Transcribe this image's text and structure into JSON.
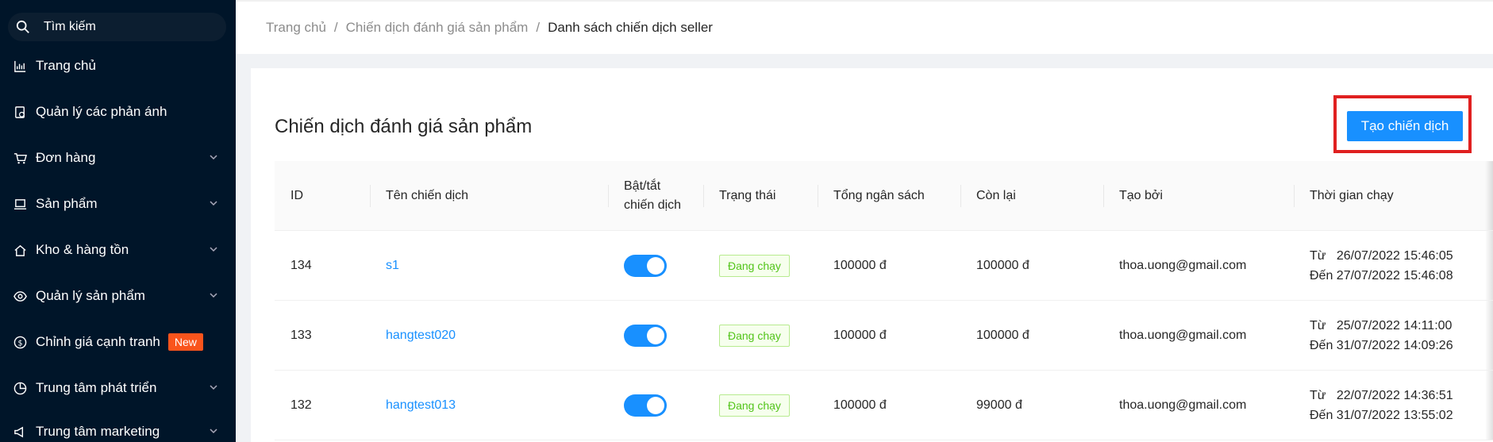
{
  "sidebar": {
    "search_placeholder": "Tìm kiếm",
    "items": [
      {
        "label": "Trang chủ",
        "icon": "chart-icon",
        "expandable": false
      },
      {
        "label": "Quản lý các phản ánh",
        "icon": "report-icon",
        "expandable": false
      },
      {
        "label": "Đơn hàng",
        "icon": "cart-icon",
        "expandable": true
      },
      {
        "label": "Sản phẩm",
        "icon": "laptop-icon",
        "expandable": true
      },
      {
        "label": "Kho & hàng tồn",
        "icon": "home-icon",
        "expandable": true
      },
      {
        "label": "Quản lý sản phẩm",
        "icon": "eye-icon",
        "expandable": true
      },
      {
        "label": "Chỉnh giá cạnh tranh",
        "icon": "dollar-icon",
        "expandable": false,
        "badge": "New"
      },
      {
        "label": "Trung tâm phát triển",
        "icon": "pie-chart-icon",
        "expandable": true
      },
      {
        "label": "Trung tâm marketing",
        "icon": "megaphone-icon",
        "expandable": true
      }
    ]
  },
  "breadcrumb": [
    "Trang chủ",
    "Chiến dịch đánh giá sản phẩm",
    "Danh sách chiến dịch seller"
  ],
  "page": {
    "title": "Chiến dịch đánh giá sản phẩm",
    "create_button": "Tạo chiến dịch"
  },
  "table": {
    "headers": [
      "ID",
      "Tên chiến dịch",
      "Bật/tắt\nchiến dịch",
      "Trạng thái",
      "Tổng ngân sách",
      "Còn lại",
      "Tạo bởi",
      "Thời gian chạy"
    ],
    "rows": [
      {
        "id": "134",
        "name": "s1",
        "enabled": true,
        "status": "Đang chạy",
        "budget": "100000 đ",
        "remaining": "100000 đ",
        "created_by": "thoa.uong@gmail.com",
        "from": "Từ   26/07/2022 15:46:05",
        "to": "Đến 27/07/2022 15:46:08"
      },
      {
        "id": "133",
        "name": "hangtest020",
        "enabled": true,
        "status": "Đang chạy",
        "budget": "100000 đ",
        "remaining": "100000 đ",
        "created_by": "thoa.uong@gmail.com",
        "from": "Từ   25/07/2022 14:11:00",
        "to": "Đến 31/07/2022 14:09:26"
      },
      {
        "id": "132",
        "name": "hangtest013",
        "enabled": true,
        "status": "Đang chạy",
        "budget": "100000 đ",
        "remaining": "99000 đ",
        "created_by": "thoa.uong@gmail.com",
        "from": "Từ   22/07/2022 14:36:51",
        "to": "Đến 31/07/2022 13:55:02"
      }
    ]
  },
  "colors": {
    "sidebar_bg": "#001529",
    "primary": "#1890ff",
    "status_green": "#52c41a",
    "badge_orange": "#fa541c",
    "highlight_red": "#e02020"
  }
}
